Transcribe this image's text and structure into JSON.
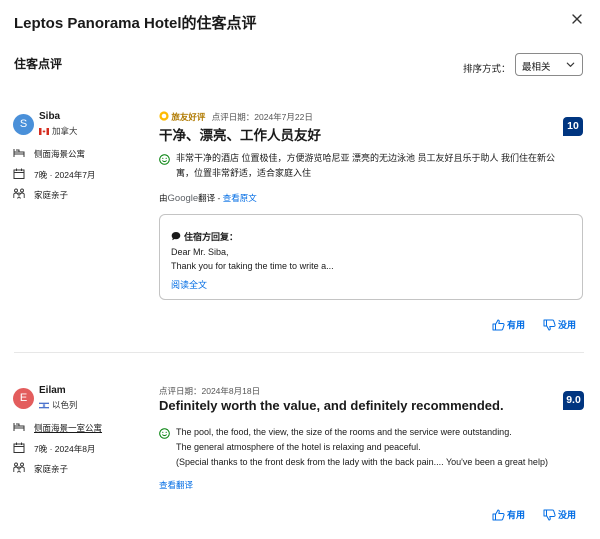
{
  "header": {
    "title": "Leptos Panorama Hotel的住客点评"
  },
  "section_title": "住客点评",
  "sort": {
    "label": "排序方式：",
    "value": "最相关"
  },
  "colors": {
    "brand": "#003580",
    "link": "#006ce4",
    "avatar1": "#4a90d9",
    "avatar2": "#e35d5d"
  },
  "reviews": [
    {
      "avatar_letter": "S",
      "name": "Siba",
      "country": "加拿大",
      "room": "侧面海景公寓",
      "stay": "7晚 · 2024年7月",
      "traveler": "家庭亲子",
      "badge": "旅友好评",
      "date": "点评日期：2024年7月22日",
      "title": "干净、漂亮、工作人员友好",
      "score": "10",
      "text_lines": [
        "非常干净的酒店 位置极佳，方便游览哈尼亚 漂亮的无边泳池 员工友好且乐于助人 我们住在新公",
        "寓，位置非常舒适，适合家庭入住"
      ],
      "translated_by_prefix": "由",
      "translated_by_brand": "Google",
      "translated_by_suffix": "翻译 - ",
      "view_original": "查看原文",
      "reply": {
        "heading": "住宿方回复：",
        "lines": [
          "Dear Mr. Siba,",
          "Thank you for taking the time to write a..."
        ],
        "read_more": "阅读全文"
      },
      "helpful": "有用",
      "not_helpful": "没用"
    },
    {
      "avatar_letter": "E",
      "name": "Eilam",
      "country": "以色列",
      "room": "侧面海景一室公寓",
      "stay": "7晚 · 2024年8月",
      "traveler": "家庭亲子",
      "date": "点评日期：2024年8月18日",
      "title": "Definitely worth the value, and definitely recommended.",
      "score": "9.0",
      "text_lines": [
        "The pool, the food, the view, the size of the rooms and the service were outstanding.",
        "The general atmosphere of the hotel is relaxing and peaceful.",
        "(Special thanks to the front desk from the lady with the back pain.... You've been a great help)"
      ],
      "view_translation": "查看翻译",
      "helpful": "有用",
      "not_helpful": "没用"
    }
  ]
}
